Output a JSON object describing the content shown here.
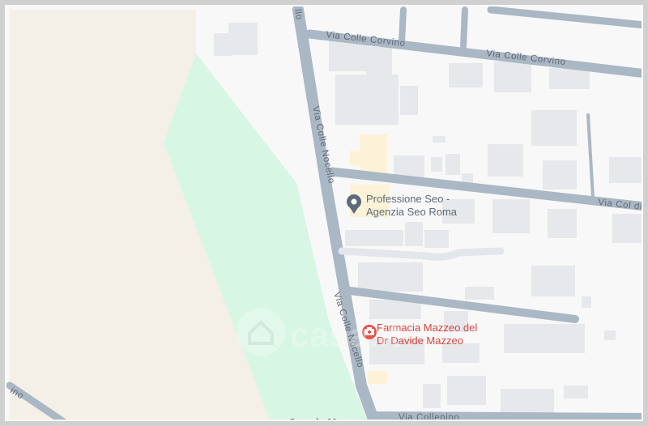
{
  "map": {
    "streets": [
      {
        "id": "via-colle-corvino-1",
        "label": "Via Colle Corvino"
      },
      {
        "id": "via-colle-corvino-2",
        "label": "Via Colle Corvino"
      },
      {
        "id": "via-colle-nocello-1",
        "label": "Via Colle Nocello"
      },
      {
        "id": "via-colle-nocello-2",
        "label": "Via Colle Nocello"
      },
      {
        "id": "via-col-di-t",
        "label": "Via Col di T"
      },
      {
        "id": "via-collepino",
        "label": "Via Collepino"
      },
      {
        "id": "via-top-left",
        "label": "llo"
      },
      {
        "id": "via-bottom-left",
        "label": "ino"
      }
    ],
    "pois": [
      {
        "id": "professione-seo",
        "lines": [
          "Professione Seo -",
          "Agenzia Seo Roma"
        ],
        "icon": "map-pin-icon",
        "color": "#5b6b79"
      },
      {
        "id": "farmacia-mazzeo",
        "lines": [
          "Farmacia Mazzeo del",
          "Dr Davide Mazzeo"
        ],
        "icon": "pharmacy-icon",
        "color": "#d8443c"
      }
    ],
    "colors": {
      "road": "#aab7c4",
      "park": "#d4f6e4",
      "land": "#f3eee6",
      "building": "#e8eaed",
      "highlight": "#fdf3d9"
    },
    "watermark": "casa.it",
    "attribution": "Google Maps"
  }
}
